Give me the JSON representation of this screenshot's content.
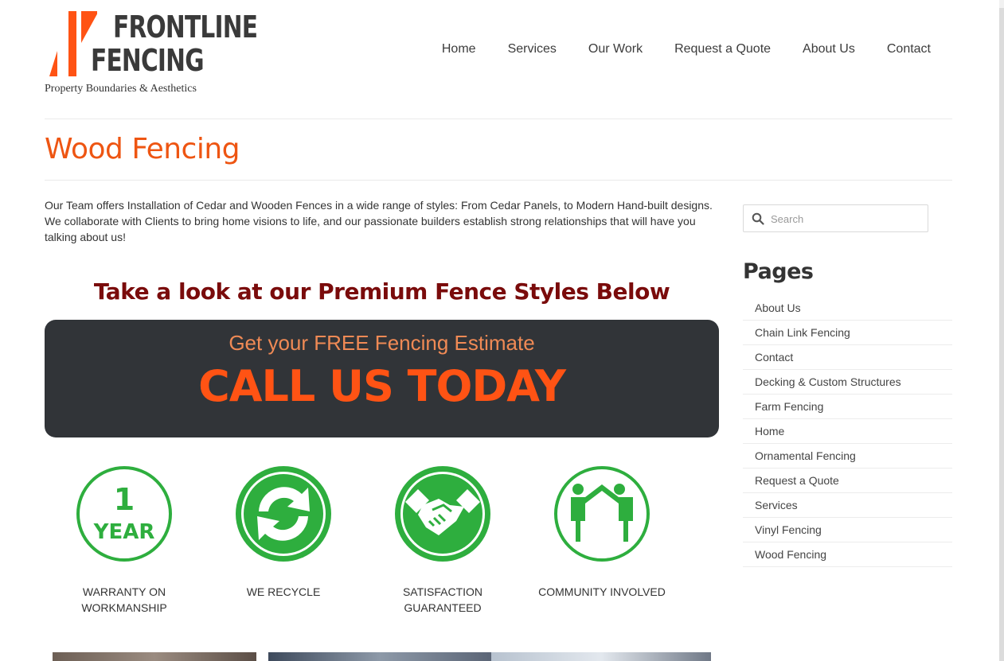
{
  "brand": {
    "name_line1": "FRONTLINE",
    "name_line2": "FENCING",
    "tagline": "Property Boundaries & Aesthetics",
    "accent_color": "#ff5314"
  },
  "nav": {
    "items": [
      {
        "label": "Home"
      },
      {
        "label": "Services"
      },
      {
        "label": "Our Work"
      },
      {
        "label": "Request a Quote"
      },
      {
        "label": "About Us"
      },
      {
        "label": "Contact"
      }
    ]
  },
  "page": {
    "title": "Wood Fencing",
    "intro": "Our Team offers Installation of Cedar and Wooden Fences in a wide range of styles: From Cedar Panels, to Modern Hand-built designs.  We collaborate with Clients to bring home visions to life, and our passionate builders establish strong relationships that will have you talking about us!",
    "subheading": "Take a look at our Premium Fence Styles Below"
  },
  "cta": {
    "line1": "Get your FREE Fencing Estimate",
    "line2": "CALL US TODAY",
    "background": "#313438"
  },
  "badges": [
    {
      "icon": "warranty-1-year-icon",
      "icon_text_top": "1",
      "icon_text_bottom": "YEAR",
      "label": "Warranty on Workmanship"
    },
    {
      "icon": "recycle-icon",
      "label": "We Recycle"
    },
    {
      "icon": "handshake-icon",
      "label": "Satisfaction Guaranteed"
    },
    {
      "icon": "community-icon",
      "label": "Community Involved"
    }
  ],
  "badge_color": "#2eae3e",
  "sidebar": {
    "search_placeholder": "Search",
    "pages_title": "Pages",
    "pages": [
      {
        "label": "About Us"
      },
      {
        "label": "Chain Link Fencing"
      },
      {
        "label": "Contact"
      },
      {
        "label": "Decking & Custom Structures"
      },
      {
        "label": "Farm Fencing"
      },
      {
        "label": "Home"
      },
      {
        "label": "Ornamental Fencing"
      },
      {
        "label": "Request a Quote"
      },
      {
        "label": "Services"
      },
      {
        "label": "Vinyl Fencing"
      },
      {
        "label": "Wood Fencing"
      }
    ]
  }
}
